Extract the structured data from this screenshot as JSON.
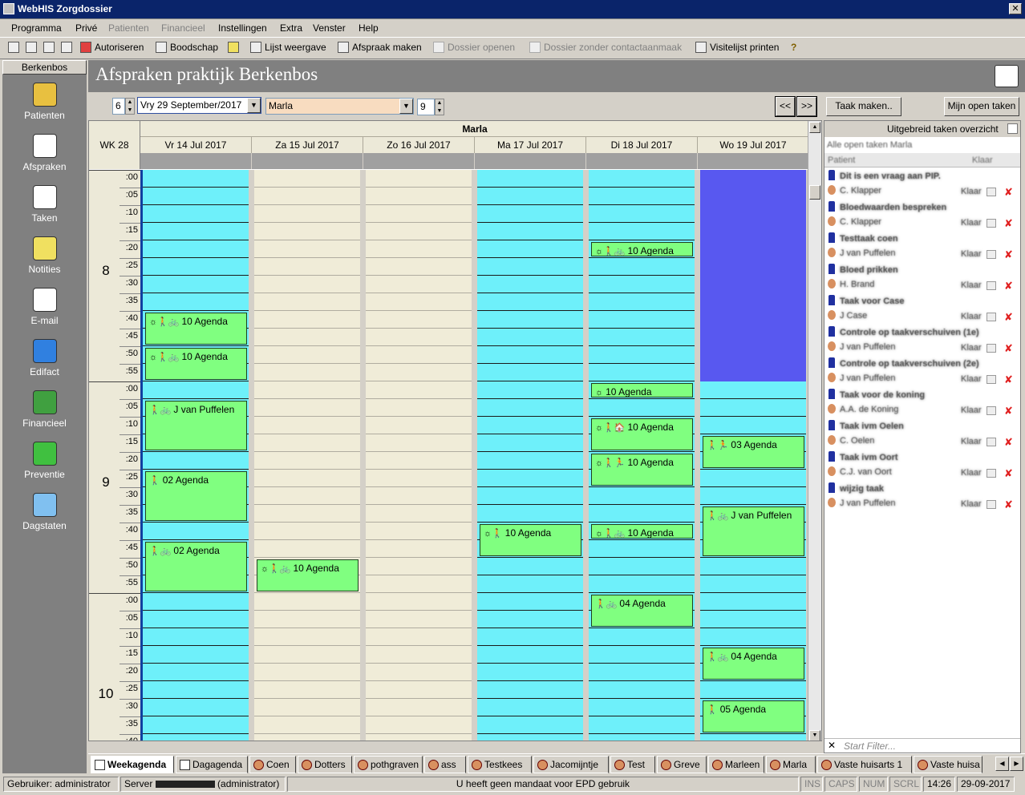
{
  "window": {
    "title": "WebHIS Zorgdossier",
    "close_glyph": "✕"
  },
  "menu": [
    {
      "label": "Programma",
      "enabled": true
    },
    {
      "label": "Privé",
      "enabled": true
    },
    {
      "label": "Patienten",
      "enabled": false
    },
    {
      "label": "Financieel",
      "enabled": false
    },
    {
      "label": "Instellingen",
      "enabled": true
    },
    {
      "label": "Extra",
      "enabled": true
    },
    {
      "label": "Venster",
      "enabled": true
    },
    {
      "label": "Help",
      "enabled": true
    }
  ],
  "toolbar": {
    "authorize": "Autoriseren",
    "message": "Boodschap",
    "list_view": "Lijst weergave",
    "make_appointment": "Afspraak maken",
    "open_dossier": "Dossier openen",
    "open_dossier_no_contact": "Dossier zonder contactaanmaak",
    "print_visit_list": "Visitelijst printen",
    "help": "?"
  },
  "sidebar": {
    "header": "Berkenbos",
    "items": [
      {
        "label": "Patienten",
        "icon": "patients-icon",
        "color": "#e8c040"
      },
      {
        "label": "Afspraken",
        "icon": "appointments-icon",
        "color": "#ffffff"
      },
      {
        "label": "Taken",
        "icon": "tasks-icon",
        "color": "#ffffff"
      },
      {
        "label": "Notities",
        "icon": "notes-icon",
        "color": "#f0e060"
      },
      {
        "label": "E-mail",
        "icon": "email-icon",
        "color": "#ffffff"
      },
      {
        "label": "Edifact",
        "icon": "globe-icon",
        "color": "#3080e0"
      },
      {
        "label": "Financieel",
        "icon": "money-icon",
        "color": "#40a040"
      },
      {
        "label": "Preventie",
        "icon": "apple-icon",
        "color": "#40c040"
      },
      {
        "label": "Dagstaten",
        "icon": "daystate-icon",
        "color": "#80c0f0"
      }
    ]
  },
  "header": {
    "title": "Afspraken praktijk Berkenbos"
  },
  "controls": {
    "weeks": "6",
    "date": "Vry 29 September/2017",
    "practitioner": "Marla",
    "hours": "9",
    "prev": "<<",
    "next": ">>",
    "make_task": "Taak maken..",
    "my_open_tasks": "Mijn open taken"
  },
  "calendar": {
    "week": "WK 28",
    "practitioner": "Marla",
    "days": [
      {
        "label": "Vr 14 Jul 2017",
        "color": "#6ef0fa"
      },
      {
        "label": "Za 15 Jul 2017",
        "color": "#f0ecd8"
      },
      {
        "label": "Zo 16 Jul 2017",
        "color": "#f0ecd8"
      },
      {
        "label": "Ma 17 Jul 2017",
        "color": "#6ef0fa"
      },
      {
        "label": "Di 18 Jul 2017",
        "color": "#6ef0fa"
      },
      {
        "label": "Wo 19 Jul 2017",
        "color": "#6ef0fa"
      }
    ],
    "hours": [
      "8",
      "9",
      "10"
    ],
    "minutes": [
      ":00",
      ":05",
      ":10",
      ":15",
      ":20",
      ":25",
      ":30",
      ":35",
      ":40",
      ":45",
      ":50",
      ":55"
    ],
    "appointments": [
      {
        "day": 0,
        "start": "8:40",
        "slots": 2,
        "text": "10 Agenda",
        "icons": "☼🚶🚲"
      },
      {
        "day": 0,
        "start": "8:50",
        "slots": 2,
        "text": "10 Agenda",
        "icons": "☼🚶🚲"
      },
      {
        "day": 0,
        "start": "9:05",
        "slots": 3,
        "text": "J van Puffelen",
        "icons": "🚶🚲"
      },
      {
        "day": 0,
        "start": "9:25",
        "slots": 3,
        "text": "02 Agenda",
        "icons": "🚶"
      },
      {
        "day": 0,
        "start": "9:45",
        "slots": 3,
        "text": "02 Agenda",
        "icons": "🚶🚲"
      },
      {
        "day": 1,
        "start": "9:50",
        "slots": 2,
        "text": "10 Agenda",
        "icons": "☼🚶🚲"
      },
      {
        "day": 3,
        "start": "9:40",
        "slots": 2,
        "text": "10 Agenda",
        "icons": "☼🚶"
      },
      {
        "day": 4,
        "start": "8:20",
        "slots": 1,
        "text": "10 Agenda",
        "icons": "☼🚶🚲"
      },
      {
        "day": 4,
        "start": "9:00",
        "slots": 1,
        "text": "10 Agenda",
        "icons": "☼"
      },
      {
        "day": 4,
        "start": "9:10",
        "slots": 2,
        "text": "10 Agenda",
        "icons": "☼🚶🏠"
      },
      {
        "day": 4,
        "start": "9:20",
        "slots": 2,
        "text": "10 Agenda",
        "icons": "☼🚶🏃"
      },
      {
        "day": 4,
        "start": "9:40",
        "slots": 1,
        "text": "10 Agenda",
        "icons": "☼🚶🚲"
      },
      {
        "day": 4,
        "start": "10:00",
        "slots": 2,
        "text": "04 Agenda",
        "icons": "🚶🚲"
      },
      {
        "day": 5,
        "start": "9:15",
        "slots": 2,
        "text": "03 Agenda",
        "icons": "🚶🏃"
      },
      {
        "day": 5,
        "start": "9:35",
        "slots": 3,
        "text": "J van Puffelen",
        "icons": "🚶🚲"
      },
      {
        "day": 5,
        "start": "10:15",
        "slots": 2,
        "text": "04 Agenda",
        "icons": "🚶🚲"
      },
      {
        "day": 5,
        "start": "10:30",
        "slots": 2,
        "text": "05 Agenda",
        "icons": "🚶"
      }
    ]
  },
  "tasks": {
    "extended_overview": "Uitgebreid taken overzicht",
    "list_title": "Alle open taken Marla",
    "col_patient": "Patient",
    "col_ready": "Klaar",
    "filter_placeholder": "Start Filter...",
    "items": [
      {
        "title": "Dit is een vraag aan PIP.",
        "patient": "C. Klapper",
        "ready": "Klaar"
      },
      {
        "title": "Bloedwaarden bespreken",
        "patient": "C. Klapper",
        "ready": "Klaar"
      },
      {
        "title": "Testtaak coen",
        "patient": "J van Puffelen",
        "ready": "Klaar"
      },
      {
        "title": "Bloed prikken",
        "patient": "H. Brand",
        "ready": "Klaar"
      },
      {
        "title": "Taak voor Case",
        "patient": "J Case",
        "ready": "Klaar"
      },
      {
        "title": "Controle op taakverschuiven (1e)",
        "patient": "J van Puffelen",
        "ready": "Klaar"
      },
      {
        "title": "Controle op taakverschuiven (2e)",
        "patient": "J van Puffelen",
        "ready": "Klaar"
      },
      {
        "title": "Taak voor de koning",
        "patient": "A.A. de Koning",
        "ready": "Klaar"
      },
      {
        "title": "Taak ivm Oelen",
        "patient": "C. Oelen",
        "ready": "Klaar"
      },
      {
        "title": "Taak ivm Oort",
        "patient": "C.J. van Oort",
        "ready": "Klaar"
      },
      {
        "title": "wijzig taak",
        "patient": "J van Puffelen",
        "ready": "Klaar"
      }
    ]
  },
  "tabs": [
    {
      "label": "Weekagenda",
      "active": true,
      "w": 104
    },
    {
      "label": "Dagagenda",
      "active": false,
      "w": 90
    },
    {
      "label": "Coen",
      "active": false,
      "w": 58
    },
    {
      "label": "Dotters",
      "active": false,
      "w": 68
    },
    {
      "label": "pothgraven",
      "active": false,
      "w": 86
    },
    {
      "label": "ass",
      "active": false,
      "w": 52
    },
    {
      "label": "Testkees",
      "active": false,
      "w": 80
    },
    {
      "label": "Jacomijntje",
      "active": false,
      "w": 94
    },
    {
      "label": "Test",
      "active": false,
      "w": 56
    },
    {
      "label": "Greve",
      "active": false,
      "w": 62
    },
    {
      "label": "Marleen",
      "active": false,
      "w": 70
    },
    {
      "label": "Marla",
      "active": false,
      "w": 62
    },
    {
      "label": "Vaste huisarts 1",
      "active": false,
      "w": 118
    },
    {
      "label": "Vaste huisa",
      "active": false,
      "w": 86
    }
  ],
  "status": {
    "user": "Gebruiker: administrator",
    "server_prefix": "Server",
    "server_user": "(administrator)",
    "message": "U heeft geen mandaat voor EPD gebruik",
    "ins": "INS",
    "caps": "CAPS",
    "num": "NUM",
    "scrl": "SCRL",
    "time": "14:26",
    "date": "29-09-2017"
  }
}
